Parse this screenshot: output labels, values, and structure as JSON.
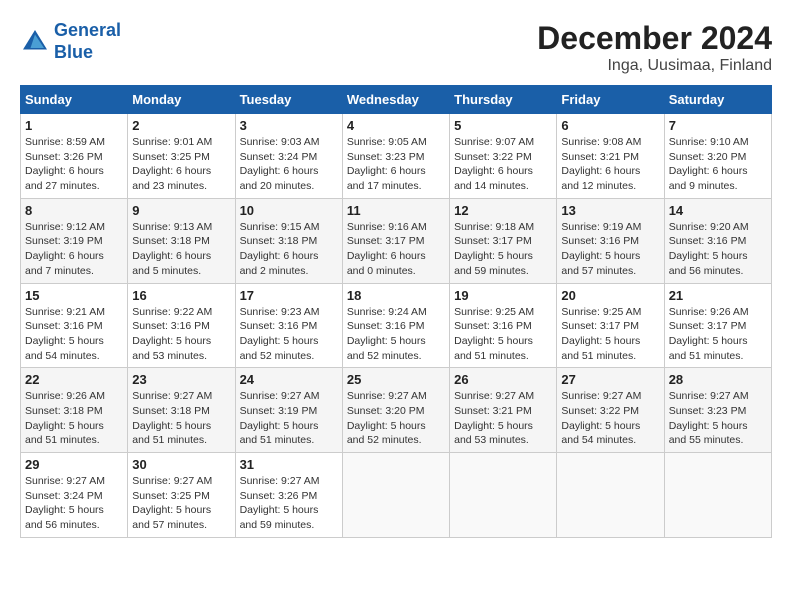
{
  "header": {
    "logo_line1": "General",
    "logo_line2": "Blue",
    "title": "December 2024",
    "subtitle": "Inga, Uusimaa, Finland"
  },
  "columns": [
    "Sunday",
    "Monday",
    "Tuesday",
    "Wednesday",
    "Thursday",
    "Friday",
    "Saturday"
  ],
  "weeks": [
    [
      {
        "day": "1",
        "detail": "Sunrise: 8:59 AM\nSunset: 3:26 PM\nDaylight: 6 hours\nand 27 minutes."
      },
      {
        "day": "2",
        "detail": "Sunrise: 9:01 AM\nSunset: 3:25 PM\nDaylight: 6 hours\nand 23 minutes."
      },
      {
        "day": "3",
        "detail": "Sunrise: 9:03 AM\nSunset: 3:24 PM\nDaylight: 6 hours\nand 20 minutes."
      },
      {
        "day": "4",
        "detail": "Sunrise: 9:05 AM\nSunset: 3:23 PM\nDaylight: 6 hours\nand 17 minutes."
      },
      {
        "day": "5",
        "detail": "Sunrise: 9:07 AM\nSunset: 3:22 PM\nDaylight: 6 hours\nand 14 minutes."
      },
      {
        "day": "6",
        "detail": "Sunrise: 9:08 AM\nSunset: 3:21 PM\nDaylight: 6 hours\nand 12 minutes."
      },
      {
        "day": "7",
        "detail": "Sunrise: 9:10 AM\nSunset: 3:20 PM\nDaylight: 6 hours\nand 9 minutes."
      }
    ],
    [
      {
        "day": "8",
        "detail": "Sunrise: 9:12 AM\nSunset: 3:19 PM\nDaylight: 6 hours\nand 7 minutes."
      },
      {
        "day": "9",
        "detail": "Sunrise: 9:13 AM\nSunset: 3:18 PM\nDaylight: 6 hours\nand 5 minutes."
      },
      {
        "day": "10",
        "detail": "Sunrise: 9:15 AM\nSunset: 3:18 PM\nDaylight: 6 hours\nand 2 minutes."
      },
      {
        "day": "11",
        "detail": "Sunrise: 9:16 AM\nSunset: 3:17 PM\nDaylight: 6 hours\nand 0 minutes."
      },
      {
        "day": "12",
        "detail": "Sunrise: 9:18 AM\nSunset: 3:17 PM\nDaylight: 5 hours\nand 59 minutes."
      },
      {
        "day": "13",
        "detail": "Sunrise: 9:19 AM\nSunset: 3:16 PM\nDaylight: 5 hours\nand 57 minutes."
      },
      {
        "day": "14",
        "detail": "Sunrise: 9:20 AM\nSunset: 3:16 PM\nDaylight: 5 hours\nand 56 minutes."
      }
    ],
    [
      {
        "day": "15",
        "detail": "Sunrise: 9:21 AM\nSunset: 3:16 PM\nDaylight: 5 hours\nand 54 minutes."
      },
      {
        "day": "16",
        "detail": "Sunrise: 9:22 AM\nSunset: 3:16 PM\nDaylight: 5 hours\nand 53 minutes."
      },
      {
        "day": "17",
        "detail": "Sunrise: 9:23 AM\nSunset: 3:16 PM\nDaylight: 5 hours\nand 52 minutes."
      },
      {
        "day": "18",
        "detail": "Sunrise: 9:24 AM\nSunset: 3:16 PM\nDaylight: 5 hours\nand 52 minutes."
      },
      {
        "day": "19",
        "detail": "Sunrise: 9:25 AM\nSunset: 3:16 PM\nDaylight: 5 hours\nand 51 minutes."
      },
      {
        "day": "20",
        "detail": "Sunrise: 9:25 AM\nSunset: 3:17 PM\nDaylight: 5 hours\nand 51 minutes."
      },
      {
        "day": "21",
        "detail": "Sunrise: 9:26 AM\nSunset: 3:17 PM\nDaylight: 5 hours\nand 51 minutes."
      }
    ],
    [
      {
        "day": "22",
        "detail": "Sunrise: 9:26 AM\nSunset: 3:18 PM\nDaylight: 5 hours\nand 51 minutes."
      },
      {
        "day": "23",
        "detail": "Sunrise: 9:27 AM\nSunset: 3:18 PM\nDaylight: 5 hours\nand 51 minutes."
      },
      {
        "day": "24",
        "detail": "Sunrise: 9:27 AM\nSunset: 3:19 PM\nDaylight: 5 hours\nand 51 minutes."
      },
      {
        "day": "25",
        "detail": "Sunrise: 9:27 AM\nSunset: 3:20 PM\nDaylight: 5 hours\nand 52 minutes."
      },
      {
        "day": "26",
        "detail": "Sunrise: 9:27 AM\nSunset: 3:21 PM\nDaylight: 5 hours\nand 53 minutes."
      },
      {
        "day": "27",
        "detail": "Sunrise: 9:27 AM\nSunset: 3:22 PM\nDaylight: 5 hours\nand 54 minutes."
      },
      {
        "day": "28",
        "detail": "Sunrise: 9:27 AM\nSunset: 3:23 PM\nDaylight: 5 hours\nand 55 minutes."
      }
    ],
    [
      {
        "day": "29",
        "detail": "Sunrise: 9:27 AM\nSunset: 3:24 PM\nDaylight: 5 hours\nand 56 minutes."
      },
      {
        "day": "30",
        "detail": "Sunrise: 9:27 AM\nSunset: 3:25 PM\nDaylight: 5 hours\nand 57 minutes."
      },
      {
        "day": "31",
        "detail": "Sunrise: 9:27 AM\nSunset: 3:26 PM\nDaylight: 5 hours\nand 59 minutes."
      },
      null,
      null,
      null,
      null
    ]
  ]
}
